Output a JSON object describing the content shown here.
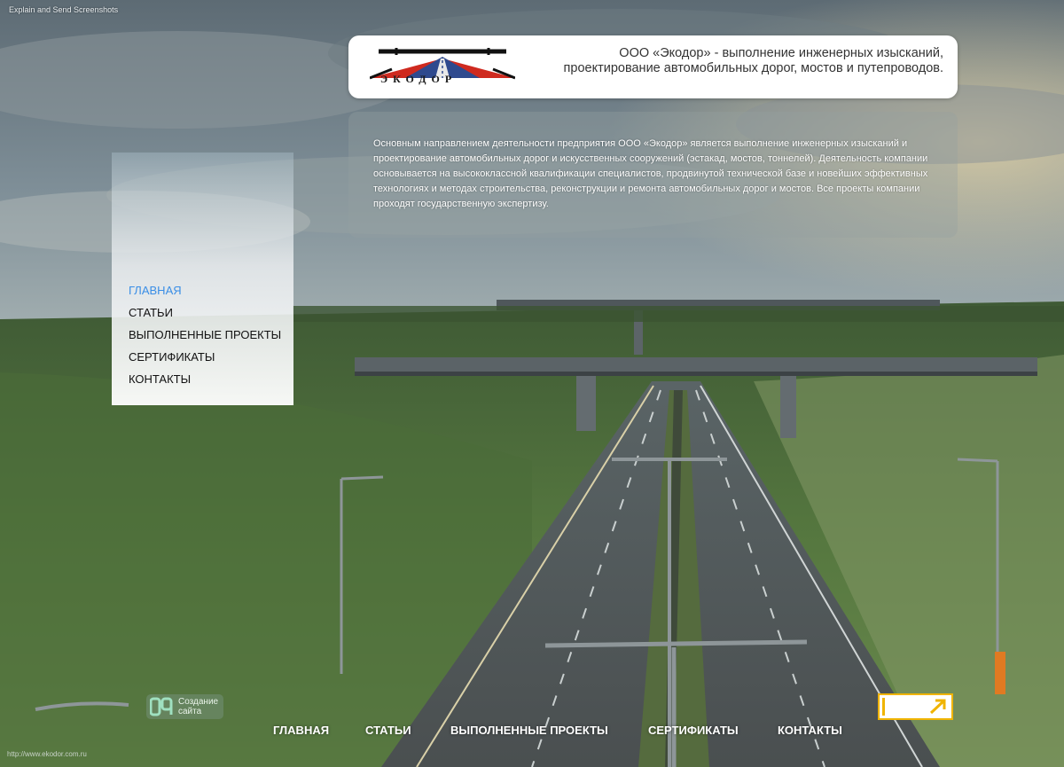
{
  "top_note": "Explain and Send Screenshots",
  "header": {
    "logo_text": "ЭКОДОР",
    "tagline_line1": "ООО «Экодор» - выполнение инженерных изысканий,",
    "tagline_line2": "проектирование автомобильных дорог, мостов и путепроводов."
  },
  "description": "Основным направлением деятельности предприятия ООО «Экодор» является выполнение инженерных изысканий и проектирование автомобильных дорог и искусственных сооружений (эстакад, мостов, тоннелей). Деятельность компании основывается на высококлассной квалификации специалистов, продвинутой технической базе и новейших эффективных технологиях и методах строительства, реконструкции и ремонта автомобильных дорог и мостов. Все проекты компании проходят государственную экспертизу.",
  "side_nav": [
    {
      "label": "Главная",
      "active": true
    },
    {
      "label": "Статьи",
      "active": false
    },
    {
      "label": "Выполненные проекты",
      "active": false
    },
    {
      "label": "Сертификаты",
      "active": false
    },
    {
      "label": "Контакты",
      "active": false
    }
  ],
  "footer_nav": [
    {
      "label": "Главная"
    },
    {
      "label": "Статьи"
    },
    {
      "label": "Выполненные проекты"
    },
    {
      "label": "Сертификаты"
    },
    {
      "label": "Контакты"
    }
  ],
  "maker": {
    "line1": "Создание",
    "line2": "сайта"
  },
  "bottom_url": "http://www.ekodor.com.ru",
  "colors": {
    "accent": "#3a8ee6",
    "badge": "#f0b400"
  }
}
